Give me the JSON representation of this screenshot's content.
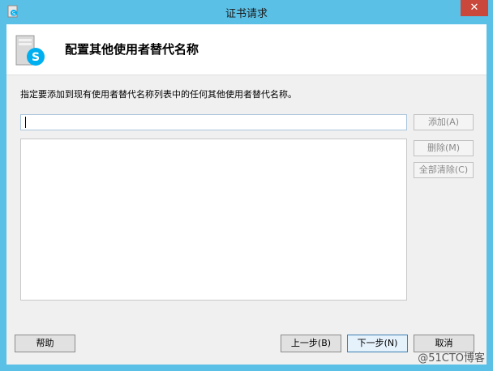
{
  "window": {
    "title": "证书请求",
    "close_glyph": "✕"
  },
  "header": {
    "title": "配置其他使用者替代名称",
    "icon": "skype-server-icon"
  },
  "body": {
    "instruction": "指定要添加到现有使用者替代名称列表中的任何其他使用者替代名称。",
    "input_value": "",
    "list_items": []
  },
  "side_buttons": {
    "add": "添加(A)",
    "remove": "删除(M)",
    "clear_all": "全部清除(C)"
  },
  "footer": {
    "help": "帮助",
    "back": "上一步(B)",
    "next": "下一步(N)",
    "cancel": "取消"
  },
  "watermark": "@51CTO博客",
  "colors": {
    "frame": "#5bc0e6",
    "close": "#c9483b",
    "skype_blue": "#00aff0"
  }
}
